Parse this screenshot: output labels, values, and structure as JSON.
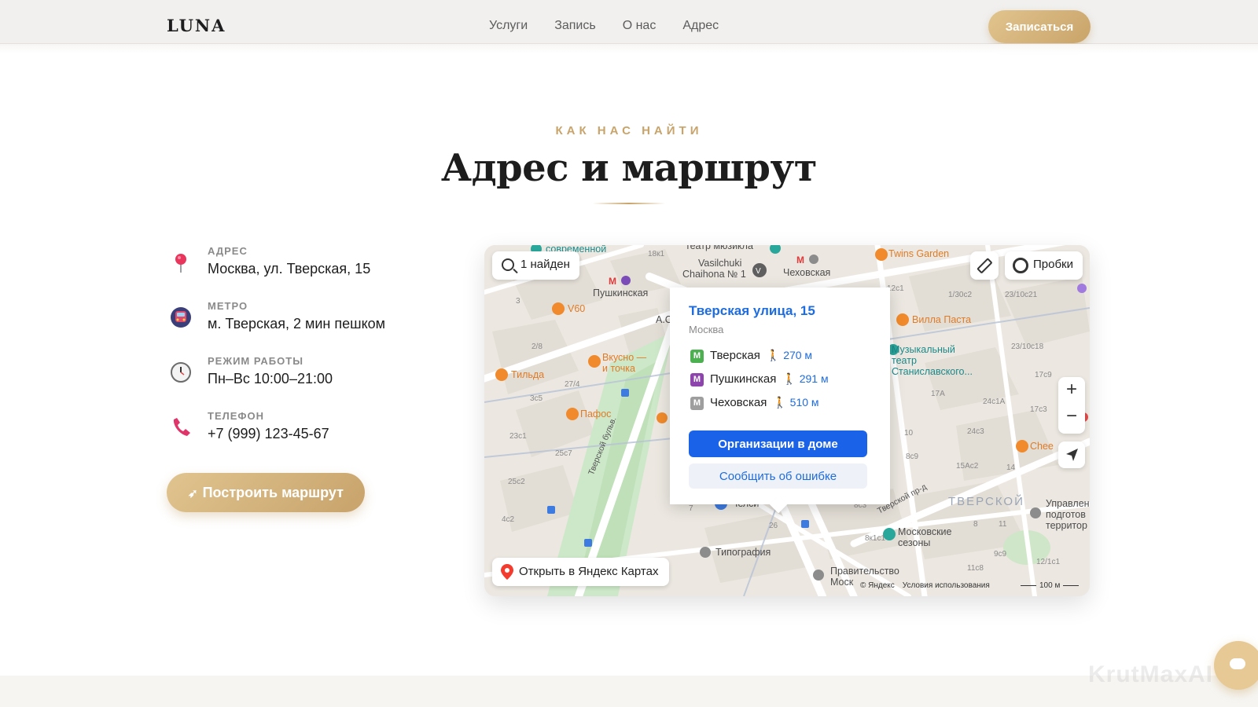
{
  "header": {
    "logo": "LUNA",
    "nav": [
      "Услуги",
      "Запись",
      "О нас",
      "Адрес"
    ],
    "cta": "Записаться"
  },
  "section": {
    "eyebrow": "КАК НАС НАЙТИ",
    "title": "Адрес и маршрут"
  },
  "info": [
    {
      "label": "АДРЕС",
      "value": "Москва, ул. Тверская, 15",
      "icon": "pin-icon"
    },
    {
      "label": "МЕТРО",
      "value": "м. Тверская, 2 мин пешком",
      "icon": "metro-icon"
    },
    {
      "label": "РЕЖИМ РАБОТЫ",
      "value": "Пн–Вс 10:00–21:00",
      "icon": "clock-icon"
    },
    {
      "label": "ТЕЛЕФОН",
      "value": "+7 (999) 123-45-67",
      "icon": "phone-icon"
    }
  ],
  "route_button": "Построить маршрут",
  "map": {
    "search_result": "1 найден",
    "traffic": "Пробки",
    "open_link": "Открыть в Яндекс Картах",
    "copyright": "© Яндекс",
    "terms": "Условия использования",
    "scale": "100 м",
    "popup": {
      "title": "Тверская улица, 15",
      "city": "Москва",
      "metro": [
        {
          "name": "Тверская",
          "distance": "270 м",
          "color": "#4caf50"
        },
        {
          "name": "Пушкинская",
          "distance": "291 м",
          "color": "#8e44ad"
        },
        {
          "name": "Чеховская",
          "distance": "510 м",
          "color": "#9e9e9e"
        }
      ],
      "primary_button": "Организации в доме",
      "secondary_button": "Сообщить об ошибке"
    },
    "labels": {
      "sovremennoy": "современной",
      "teatr_muzykla": "театр мюзикла",
      "vasilchuki": "Vasilchuki",
      "chaihona": "Chaihona № 1",
      "chekhovskaya": "Чеховская",
      "pushkinskaya": "Пушкинская",
      "twins": "Twins Garden",
      "v60": "V60",
      "villa": "Вилла Паста",
      "vkusno1": "Вкусно —",
      "vkusno2": "и точка",
      "tilda": "Тильда",
      "muz1": "Музыкальный",
      "muz2": "театр",
      "muz3": "Станиславского...",
      "pafos": "Пафос",
      "chee": "Chee",
      "chelsi": "Челси",
      "tverskoy_district": "ТВЕРСКОЙ",
      "upravlen1": "Управлен",
      "upravlen2": "подготов",
      "upravlen3": "территор",
      "mosk1": "Московские",
      "mosk2": "сезоны",
      "tipografiya": "Типография",
      "pravitelstvo1": "Правительство",
      "pravitelstvo2": "Моск",
      "tverskoy_bulvar": "Тверской бульв.",
      "tverskoy_pr": "Тверской пр-д",
      "ac": "А.С"
    },
    "house_numbers": [
      "18к1",
      "1/30с2",
      "23/10с21",
      "23/10с18",
      "17с9",
      "17А",
      "24с1А",
      "17с3",
      "24с3",
      "15Ас2",
      "8с9",
      "14",
      "2/8",
      "27/4",
      "3с5",
      "23с1",
      "25с7",
      "25с2",
      "4с2",
      "3",
      "10",
      "8с3",
      "8к1с1",
      "11с8",
      "9с9",
      "12/1с1",
      "26",
      "8",
      "11",
      "7",
      "12с1"
    ]
  },
  "watermark": "KrutMaxAI"
}
